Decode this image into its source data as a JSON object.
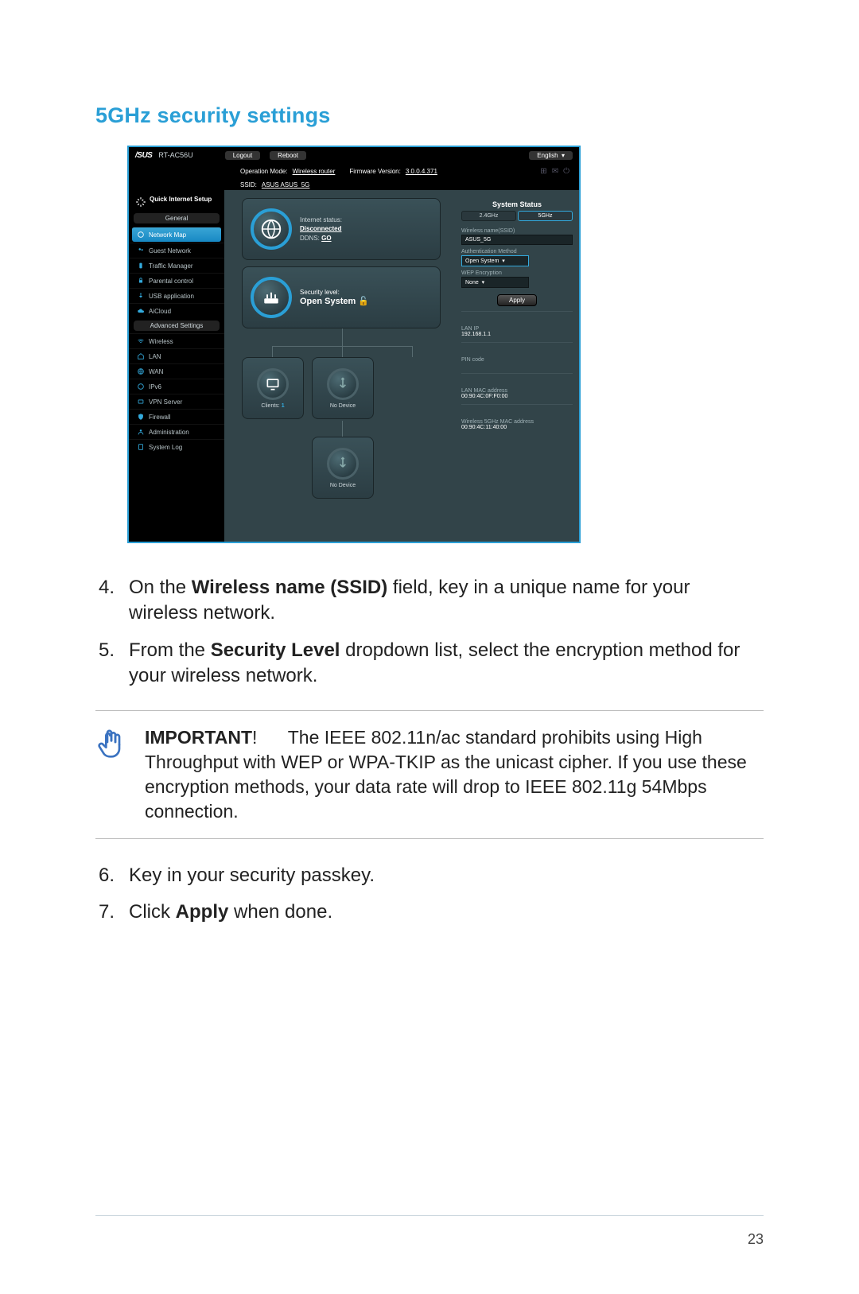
{
  "page": {
    "title": "5GHz security settings",
    "number": "23"
  },
  "router": {
    "brand": "/SUS",
    "model": "RT-AC56U",
    "logout": "Logout",
    "reboot": "Reboot",
    "language": "English",
    "op_mode_label": "Operation Mode:",
    "op_mode": "Wireless router",
    "fw_label": "Firmware Version:",
    "fw": "3.0.0.4.371",
    "ssid_label": "SSID:",
    "ssid_vals": "ASUS  ASUS_5G",
    "quick_setup": "Quick Internet Setup",
    "sections": {
      "general": "General",
      "advanced": "Advanced Settings"
    },
    "nav_general": [
      {
        "label": "Network Map",
        "active": true
      },
      {
        "label": "Guest Network",
        "active": false
      },
      {
        "label": "Traffic Manager",
        "active": false
      },
      {
        "label": "Parental control",
        "active": false
      },
      {
        "label": "USB application",
        "active": false
      },
      {
        "label": "AiCloud",
        "active": false
      }
    ],
    "nav_advanced": [
      {
        "label": "Wireless"
      },
      {
        "label": "LAN"
      },
      {
        "label": "WAN"
      },
      {
        "label": "IPv6"
      },
      {
        "label": "VPN Server"
      },
      {
        "label": "Firewall"
      },
      {
        "label": "Administration"
      },
      {
        "label": "System Log"
      }
    ],
    "globe": {
      "status_label": "Internet status:",
      "status_value": "Disconnected",
      "ddns_label": "DDNS:",
      "ddns_value": "GO"
    },
    "security": {
      "label": "Security level:",
      "value": "Open System"
    },
    "clients": {
      "label": "Clients:",
      "value": "1"
    },
    "usb_none": "No Device",
    "panel": {
      "title": "System Status",
      "tab24": "2.4GHz",
      "tab5": "5GHz",
      "ssid_label": "Wireless name(SSID)",
      "ssid_value": "ASUS_5G",
      "auth_label": "Authentication Method",
      "auth_value": "Open System",
      "wep_label": "WEP Encryption",
      "wep_value": "None",
      "apply": "Apply",
      "lan_ip_label": "LAN IP",
      "lan_ip": "192.168.1.1",
      "pin_label": "PIN code",
      "lan_mac_label": "LAN MAC address",
      "lan_mac": "00:90:4C:0F:F0:00",
      "wmac_label": "Wireless 5GHz MAC address",
      "wmac": "00:90:4C:11:40:00"
    }
  },
  "steps": {
    "s4_num": "4.",
    "s4_a": "On the ",
    "s4_b": "Wireless name (SSID)",
    "s4_c": " field, key in a unique name for your wireless network.",
    "s5_num": "5.",
    "s5_a": "From the ",
    "s5_b": "Security Level",
    "s5_c": " dropdown list, select the encryption method for your wireless network.",
    "s6_num": "6.",
    "s6": "Key in your security passkey.",
    "s7_num": "7.",
    "s7_a": "Click ",
    "s7_b": "Apply",
    "s7_c": " when done."
  },
  "note": {
    "head": "IMPORTANT",
    "bang": "!",
    "body": "The IEEE 802.11n/ac standard prohibits using High Throughput with WEP or WPA-TKIP as the unicast cipher. If you use these encryption methods, your data rate will drop to IEEE 802.11g 54Mbps connection."
  }
}
